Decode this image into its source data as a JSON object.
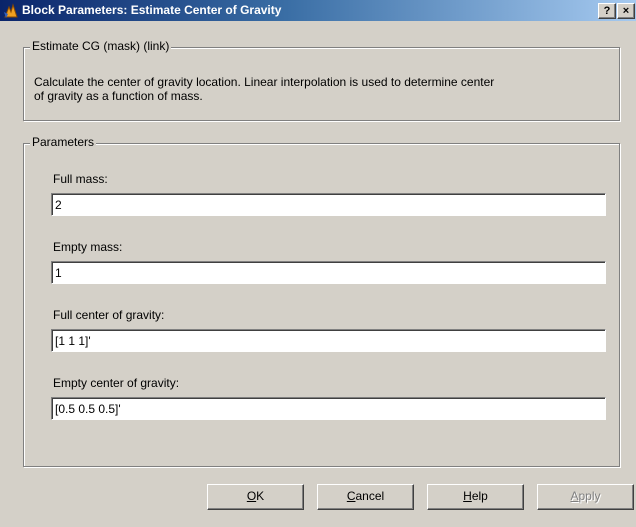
{
  "window": {
    "title": "Block Parameters: Estimate Center of Gravity",
    "help_button": "?",
    "close_button": "×"
  },
  "mask_group": {
    "legend": "Estimate CG (mask) (link)",
    "description_line1": "Calculate the center of gravity location.  Linear interpolation is used to determine center",
    "description_line2": "of gravity as a function of mass."
  },
  "parameters": {
    "legend": "Parameters",
    "fields": [
      {
        "label": "Full mass:",
        "value": "2"
      },
      {
        "label": "Empty mass:",
        "value": "1"
      },
      {
        "label": "Full center of gravity:",
        "value": "[1 1 1]'"
      },
      {
        "label": "Empty center of gravity:",
        "value": "[0.5 0.5 0.5]'"
      }
    ]
  },
  "buttons": {
    "ok": {
      "mnemonic": "O",
      "rest": "K"
    },
    "cancel": {
      "mnemonic": "C",
      "rest": "ancel"
    },
    "help": {
      "mnemonic": "H",
      "rest": "elp"
    },
    "apply": {
      "mnemonic": "A",
      "rest": "pply",
      "enabled": false
    }
  },
  "icons": {
    "title_icon": "simulink-block-icon"
  },
  "colors": {
    "dialog_bg": "#d4d0c8",
    "titlebar_start": "#0a246a",
    "titlebar_end": "#a6caf0"
  }
}
